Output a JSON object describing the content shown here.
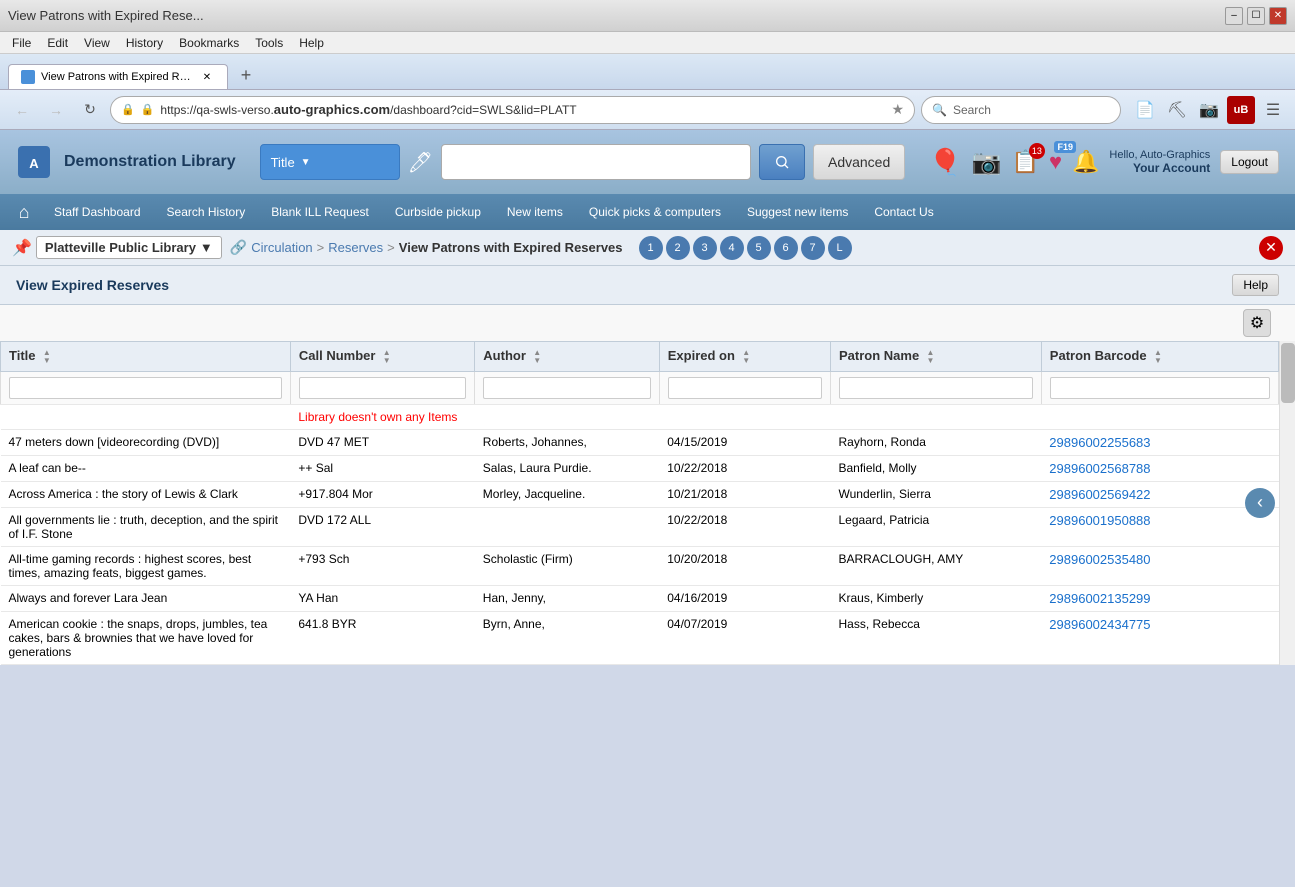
{
  "browser": {
    "tab_title": "View Patrons with Expired Rese...",
    "url": "https://qa-swls-verso.auto-graphics.com/dashboard?cid=SWLS&lid=PLATT",
    "search_placeholder": "Search"
  },
  "menu": {
    "items": [
      "File",
      "Edit",
      "View",
      "History",
      "Bookmarks",
      "Tools",
      "Help"
    ]
  },
  "app": {
    "title": "Demonstration Library",
    "search": {
      "dropdown_label": "Title",
      "advanced_label": "Advanced",
      "search_label": "Search",
      "placeholder": ""
    },
    "user": {
      "greeting": "Hello, Auto-Graphics",
      "account": "Your Account",
      "logout": "Logout"
    }
  },
  "nav": {
    "home_icon": "home",
    "items": [
      "Staff Dashboard",
      "Search History",
      "Blank ILL Request",
      "Curbside pickup",
      "New items",
      "Quick picks & computers",
      "Suggest new items",
      "Contact Us"
    ]
  },
  "breadcrumb": {
    "location": "Platteville Public Library",
    "path": [
      "Circulation",
      "Reserves",
      "View Patrons with Expired Reserves"
    ],
    "pages": [
      "1",
      "2",
      "3",
      "4",
      "5",
      "6",
      "7",
      "L"
    ]
  },
  "content": {
    "title": "View Expired Reserves",
    "help_label": "Help"
  },
  "table": {
    "columns": [
      {
        "id": "title",
        "label": "Title"
      },
      {
        "id": "call_number",
        "label": "Call Number"
      },
      {
        "id": "author",
        "label": "Author"
      },
      {
        "id": "expired_on",
        "label": "Expired on"
      },
      {
        "id": "patron_name",
        "label": "Patron Name"
      },
      {
        "id": "patron_barcode",
        "label": "Patron Barcode"
      }
    ],
    "error_message": "Library doesn't own any Items",
    "rows": [
      {
        "title": "47 meters down [videorecording (DVD)]",
        "call_number": "DVD 47 MET",
        "author": "Roberts, Johannes,",
        "expired_on": "04/15/2019",
        "patron_name": "Rayhorn, Ronda",
        "patron_barcode": "29896002255683"
      },
      {
        "title": "A leaf can be--",
        "call_number": "++ Sal",
        "author": "Salas, Laura Purdie.",
        "expired_on": "10/22/2018",
        "patron_name": "Banfield, Molly",
        "patron_barcode": "29896002568788"
      },
      {
        "title": "Across America : the story of Lewis & Clark",
        "call_number": "+917.804 Mor",
        "author": "Morley, Jacqueline.",
        "expired_on": "10/21/2018",
        "patron_name": "Wunderlin, Sierra",
        "patron_barcode": "29896002569422"
      },
      {
        "title": "All governments lie : truth, deception, and the spirit of I.F. Stone",
        "call_number": "DVD 172 ALL",
        "author": "",
        "expired_on": "10/22/2018",
        "patron_name": "Legaard, Patricia",
        "patron_barcode": "29896001950888"
      },
      {
        "title": "All-time gaming records : highest scores, best times, amazing feats, biggest games.",
        "call_number": "+793 Sch",
        "author": "Scholastic (Firm)",
        "expired_on": "10/20/2018",
        "patron_name": "BARRACLOUGH, AMY",
        "patron_barcode": "29896002535480"
      },
      {
        "title": "Always and forever Lara Jean",
        "call_number": "YA Han",
        "author": "Han, Jenny,",
        "expired_on": "04/16/2019",
        "patron_name": "Kraus, Kimberly",
        "patron_barcode": "29896002135299"
      },
      {
        "title": "American cookie : the snaps, drops, jumbles, tea cakes, bars & brownies that we have loved for generations",
        "call_number": "641.8 BYR",
        "author": "Byrn, Anne,",
        "expired_on": "04/07/2019",
        "patron_name": "Hass, Rebecca",
        "patron_barcode": "29896002434775"
      }
    ]
  }
}
